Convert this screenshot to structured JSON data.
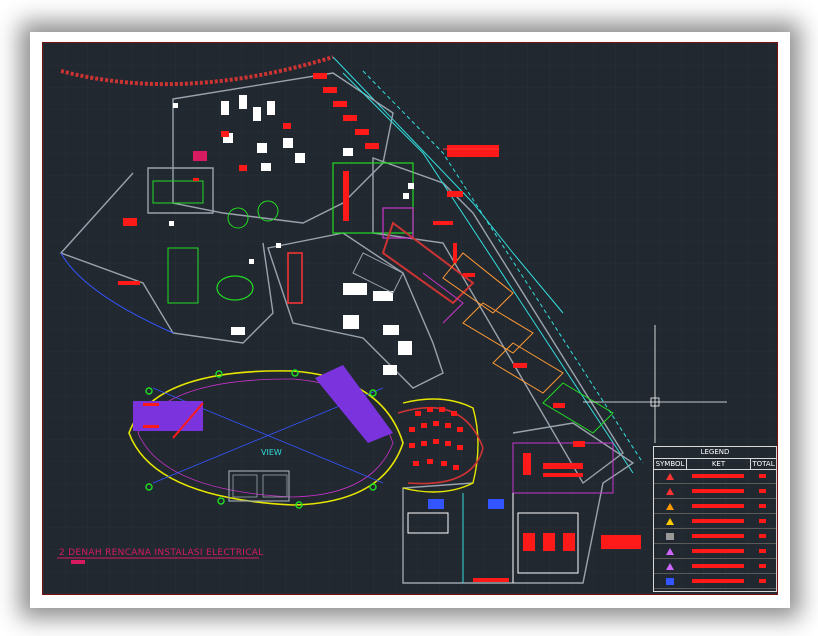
{
  "drawing": {
    "title": "2   DENAH RENCANA INSTALASI ELECTRICAL",
    "hall_label": "VIEW"
  },
  "legend": {
    "title": "LEGEND",
    "col_symbol": "SYMBOL",
    "col_ket": "KET",
    "col_total": "TOTAL",
    "rows": [
      {
        "symbol": "triangle-icon",
        "color": "#ff3333"
      },
      {
        "symbol": "triangle-icon",
        "color": "#ff3333"
      },
      {
        "symbol": "triangle-icon",
        "color": "#ff9900"
      },
      {
        "symbol": "triangle-icon",
        "color": "#ffcc00"
      },
      {
        "symbol": "square-icon",
        "color": "#999999"
      },
      {
        "symbol": "triangle-icon",
        "color": "#cc66ff"
      },
      {
        "symbol": "triangle-icon",
        "color": "#cc66ff"
      },
      {
        "symbol": "square-icon",
        "color": "#3355ff"
      }
    ]
  },
  "colors": {
    "background": "#212830",
    "wall": "#9aa3ad",
    "accent_red": "#ff1a1a",
    "accent_green": "#22dd22",
    "accent_yellow": "#e6e600",
    "accent_cyan": "#33dddd",
    "accent_magenta": "#cc33cc",
    "accent_purple": "#8833ee"
  }
}
